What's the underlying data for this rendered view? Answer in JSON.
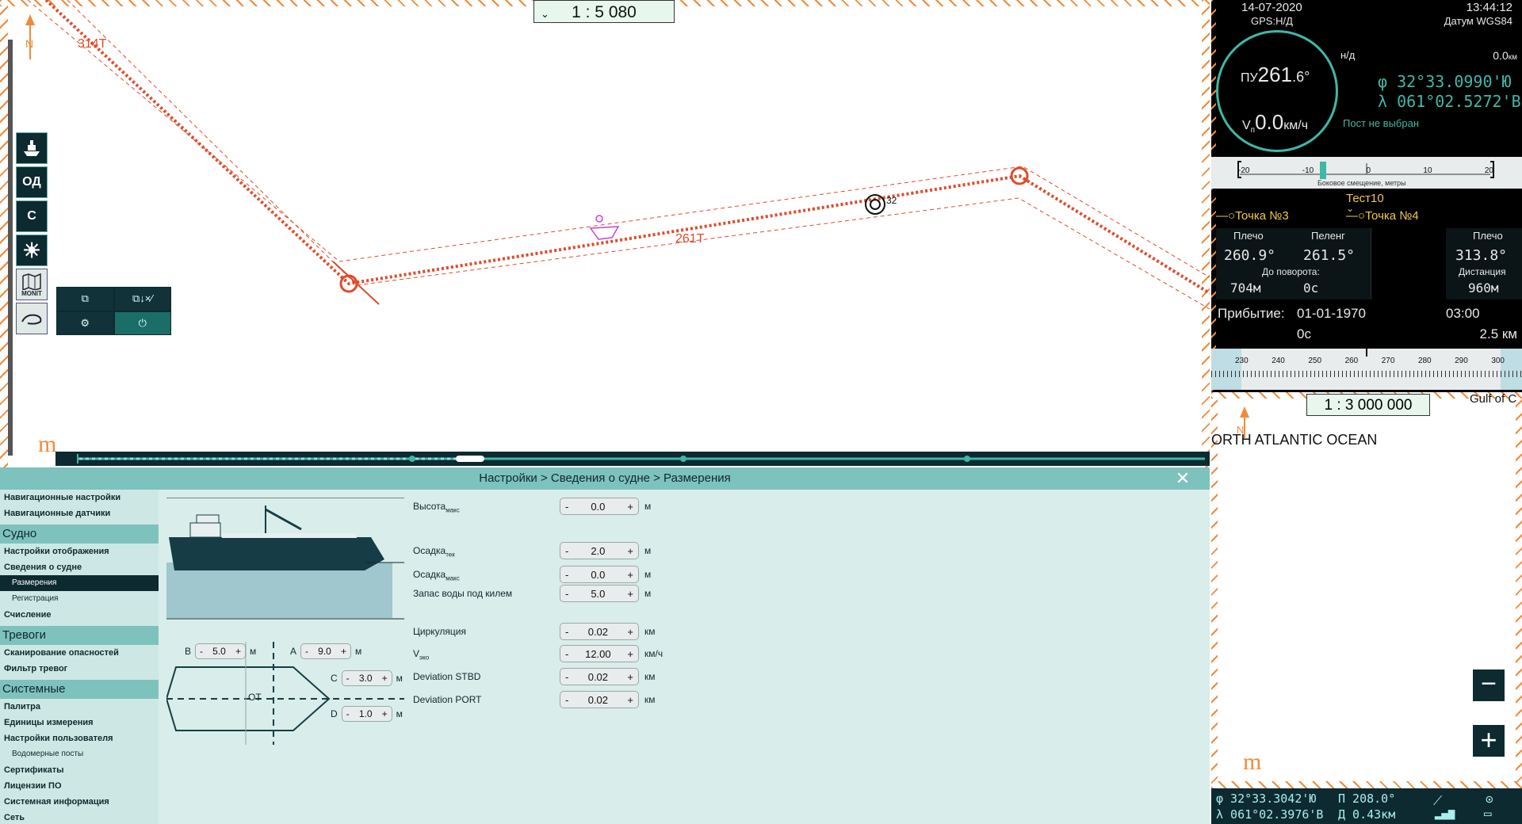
{
  "chart": {
    "scale": "1 : 5 080",
    "route_label_1": "314T",
    "route_label_2": "261T",
    "target_label": "32",
    "tools": {
      "od": "ОД",
      "c": "С",
      "monit": "MONIT"
    },
    "colors": {
      "route": "#e04a2a",
      "hatch": "#f08a3c",
      "accent": "#1f8f83"
    }
  },
  "settings": {
    "breadcrumb": "Настройки > Сведения о судне > Размерения",
    "nav": [
      {
        "label": "Навигационные настройки",
        "type": "item"
      },
      {
        "label": "Навигационные датчики",
        "type": "item"
      },
      {
        "label": "Судно",
        "type": "section"
      },
      {
        "label": "Настройки отображения",
        "type": "item"
      },
      {
        "label": "Сведения о судне",
        "type": "item"
      },
      {
        "label": "Размерения",
        "type": "sub-active"
      },
      {
        "label": "Регистрация",
        "type": "sub"
      },
      {
        "label": "Счисление",
        "type": "item"
      },
      {
        "label": "Тревоги",
        "type": "section"
      },
      {
        "label": "Сканирование опасностей",
        "type": "item"
      },
      {
        "label": "Фильтр тревог",
        "type": "item"
      },
      {
        "label": "Системные",
        "type": "section"
      },
      {
        "label": "Палитра",
        "type": "item"
      },
      {
        "label": "Единицы измерения",
        "type": "item"
      },
      {
        "label": "Настройки пользователя",
        "type": "item"
      },
      {
        "label": "Водомерные посты",
        "type": "sub"
      },
      {
        "label": "Сертификаты",
        "type": "item"
      },
      {
        "label": "Лицензии ПО",
        "type": "item"
      },
      {
        "label": "Системная информация",
        "type": "item"
      },
      {
        "label": "Сеть",
        "type": "item"
      }
    ],
    "fields": {
      "height_max": {
        "label": "Высота",
        "sub": "макс",
        "value": "0.0",
        "unit": "м"
      },
      "draft_cur": {
        "label": "Осадка",
        "sub": "тек",
        "value": "2.0",
        "unit": "м"
      },
      "draft_max": {
        "label": "Осадка",
        "sub": "макс",
        "value": "0.0",
        "unit": "м"
      },
      "keel_clearance": {
        "label": "Запас воды под килем",
        "value": "5.0",
        "unit": "м"
      },
      "circulation": {
        "label": "Циркуляция",
        "value": "0.02",
        "unit": "км"
      },
      "v_eco": {
        "label": "V",
        "sub": "эко",
        "value": "12.00",
        "unit": "км/ч"
      },
      "dev_stbd": {
        "label": "Deviation STBD",
        "value": "0.02",
        "unit": "км"
      },
      "dev_port": {
        "label": "Deviation PORT",
        "value": "0.02",
        "unit": "км"
      }
    },
    "dims": {
      "b": {
        "label": "B",
        "value": "5.0",
        "unit": "м"
      },
      "a": {
        "label": "A",
        "value": "9.0",
        "unit": "м"
      },
      "c": {
        "label": "C",
        "value": "3.0",
        "unit": "м"
      },
      "d": {
        "label": "D",
        "value": "1.0",
        "unit": "м"
      },
      "ot": "ОТ"
    },
    "minus": "-",
    "plus": "+"
  },
  "nav": {
    "date": "14-07-2020",
    "time": "13:44:12",
    "gps": "GPS:Н/Д",
    "datum": "Датум WGS84",
    "heading_label": "ПУ",
    "heading_int": "261",
    "heading_dec": ".6°",
    "speed_label": "V",
    "speed_sub": "п",
    "speed_value": "0.0",
    "speed_unit": "км/ч",
    "nd": "н/д",
    "dist": "0.0",
    "dist_unit": "км",
    "lat": "φ  32°33.0990'Ю",
    "lon": "λ 061°02.5272'В",
    "post": "Пост не выбран",
    "xte_ticks": [
      "-20",
      "-10",
      "0",
      "10",
      "20"
    ],
    "xte_caption": "Боковое смещение, метры",
    "route_name": "Тест10",
    "wp_from": "Точка №3",
    "wp_to": "Точка №4",
    "leg_label": "Плечо",
    "bearing_label": "Пеленг",
    "leg_value": "260.9°",
    "bearing_value": "261.5°",
    "to_turn_label": "До поворота:",
    "to_turn_dist": "704м",
    "to_turn_time": "0с",
    "next_leg_label": "Плечо",
    "next_leg_value": "313.8°",
    "distance_label": "Дистанция",
    "distance_value": "960м",
    "arrival_label": "Прибытие:",
    "arrival_date": "01-01-1970",
    "arrival_time": "03:00",
    "arrival_rem": "0с",
    "arrival_dist": "2.5 км",
    "compass_ticks": [
      "230",
      "240",
      "250",
      "260",
      "270",
      "280",
      "290",
      "300"
    ]
  },
  "overview": {
    "scale": "1 : 3 000 000",
    "ocean": "ORTH ATLANTIC OCEAN",
    "gulf": "Gulf of C"
  },
  "status": {
    "lat": "φ  32°33.3042'Ю",
    "lon": "λ 061°02.3976'В",
    "bearing": "П 208.0°",
    "distance": "Д 0.43км"
  }
}
